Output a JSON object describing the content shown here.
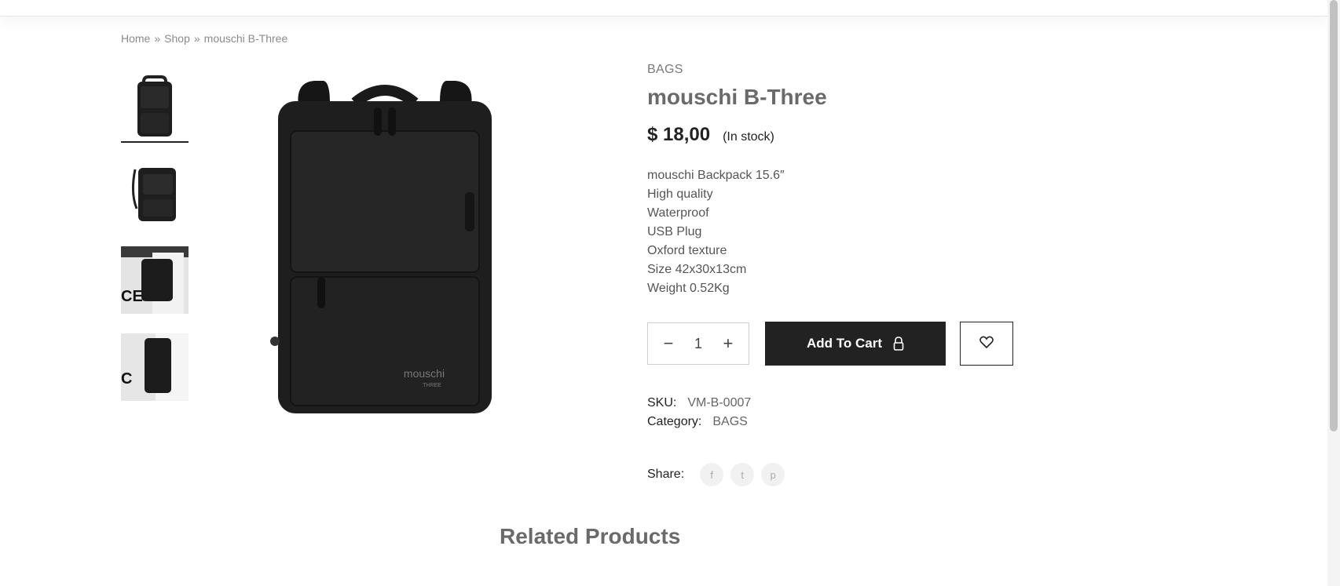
{
  "breadcrumb": {
    "home": "Home",
    "sep": "»",
    "shop": "Shop",
    "current": "mouschi B-Three"
  },
  "product": {
    "category_tag": "BAGS",
    "title": "mouschi B-Three",
    "price": "$ 18,00",
    "stock": "(In stock)",
    "description": [
      "mouschi Backpack 15.6″",
      "High quality",
      "Waterproof",
      "USB Plug",
      "Oxford texture",
      "Size 42x30x13cm",
      "Weight 0.52Kg"
    ],
    "brand_print": "mouschi",
    "brand_sub": "THREE"
  },
  "cart": {
    "quantity": "1",
    "minus": "−",
    "plus": "+",
    "add_label": "Add To Cart"
  },
  "meta": {
    "sku_label": "SKU:",
    "sku_value": "VM-B-0007",
    "category_label": "Category:",
    "category_value": "BAGS"
  },
  "share": {
    "label": "Share:",
    "icons": [
      "facebook-icon",
      "twitter-icon",
      "pinterest-icon"
    ],
    "glyphs": [
      "f",
      "t",
      "p"
    ]
  },
  "related": {
    "title": "Related Products"
  },
  "colors": {
    "button_bg": "#222222",
    "title": "#6a6a6a",
    "bag": "#1e1e1e"
  }
}
